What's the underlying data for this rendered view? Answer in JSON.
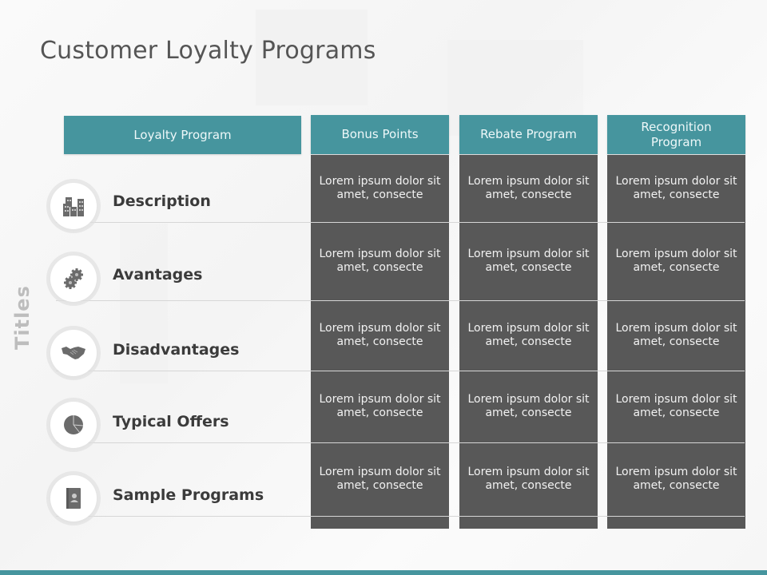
{
  "slide": {
    "title": "Customer Loyalty Programs",
    "side_label": "Titles",
    "accent_color": "#46959e",
    "cell_color": "#585858"
  },
  "header": {
    "row_header": "Loyalty Program",
    "columns": [
      "Bonus Points",
      "Rebate Program",
      "Recognition Program"
    ]
  },
  "rows": [
    {
      "label": "Description",
      "icon": "buildings-icon",
      "cells": [
        "Lorem ipsum dolor sit amet, consecte",
        "Lorem ipsum dolor sit amet, consecte",
        "Lorem ipsum dolor sit amet, consecte"
      ]
    },
    {
      "label": "Avantages",
      "icon": "gears-icon",
      "cells": [
        "Lorem ipsum dolor sit amet, consecte",
        "Lorem ipsum dolor sit amet, consecte",
        "Lorem ipsum dolor sit amet, consecte"
      ]
    },
    {
      "label": "Disadvantages",
      "icon": "handshake-icon",
      "cells": [
        "Lorem ipsum dolor sit amet, consecte",
        "Lorem ipsum dolor sit amet, consecte",
        "Lorem ipsum dolor sit amet, consecte"
      ]
    },
    {
      "label": "Typical Offers",
      "icon": "pie-chart-icon",
      "cells": [
        "Lorem ipsum dolor sit amet, consecte",
        "Lorem ipsum dolor sit amet, consecte",
        "Lorem ipsum dolor sit amet, consecte"
      ]
    },
    {
      "label": "Sample Programs",
      "icon": "contact-book-icon",
      "cells": [
        "Lorem ipsum dolor sit amet, consecte",
        "Lorem ipsum dolor sit amet, consecte",
        "Lorem ipsum dolor sit amet, consecte"
      ]
    }
  ]
}
